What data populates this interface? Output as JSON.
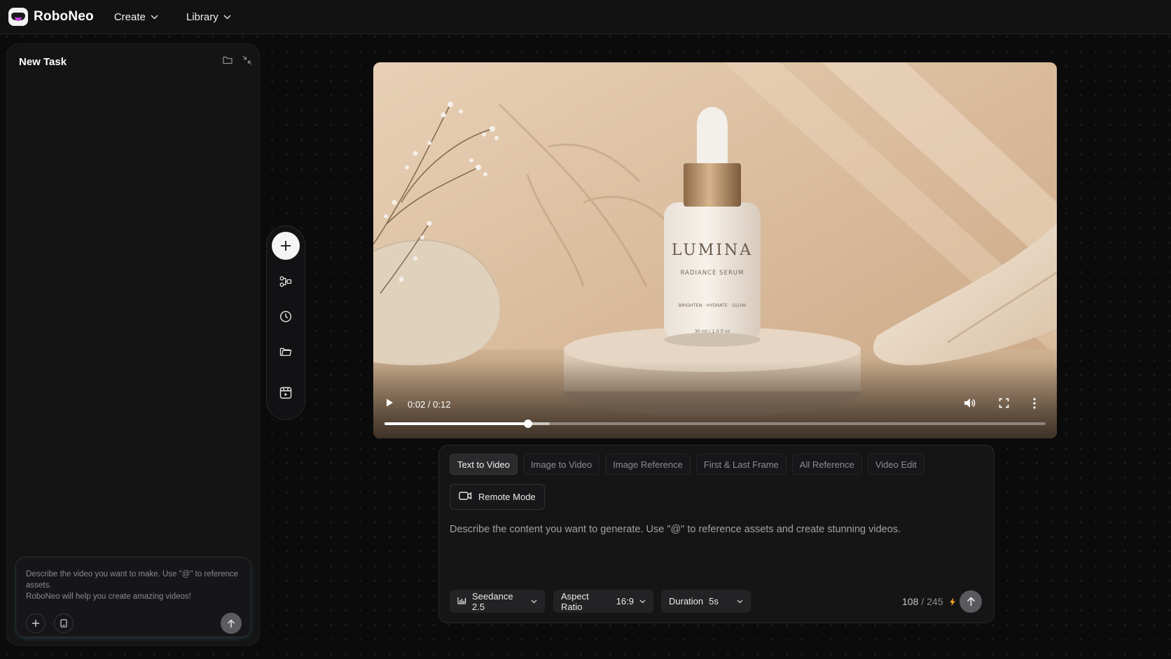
{
  "app": {
    "name": "RoboNeo",
    "nav": [
      {
        "label": "Create"
      },
      {
        "label": "Library"
      }
    ]
  },
  "left_panel": {
    "title": "New Task",
    "input_placeholder_line1": "Describe the video you want to make. Use \"@\" to reference assets.",
    "input_placeholder_line2": "RoboNeo will help you create amazing videos!"
  },
  "video": {
    "product_brand": "LUMINA",
    "product_name": "RADIANCE SERUM",
    "product_tagline": "BRIGHTEN · HYDRATE · GLOW",
    "product_volume": "30 ml / 1.0 fl oz",
    "time_display": "0:02 / 0:12",
    "progress_fraction": 0.2167,
    "buffered_fraction": 0.25
  },
  "generator": {
    "tabs": [
      {
        "label": "Text to Video",
        "active": true
      },
      {
        "label": "Image to Video",
        "active": false
      },
      {
        "label": "Image Reference",
        "active": false
      },
      {
        "label": "First & Last Frame",
        "active": false
      },
      {
        "label": "All Reference",
        "active": false
      },
      {
        "label": "Video Edit",
        "active": false
      }
    ],
    "remote_mode_label": "Remote Mode",
    "prompt_placeholder": "Describe the content you want to generate. Use \"@\" to reference assets and create stunning videos.",
    "model": {
      "value": "Seedance 2.5"
    },
    "aspect_ratio": {
      "label": "Aspect Ratio",
      "value": "16:9"
    },
    "duration": {
      "label": "Duration",
      "value": "5s"
    },
    "credits_used": "108",
    "credits_separator": "/",
    "credits_total": "245"
  },
  "colors": {
    "accent_bolt": "#f5a524",
    "background": "#0b0b0c",
    "panel": "#141415"
  }
}
